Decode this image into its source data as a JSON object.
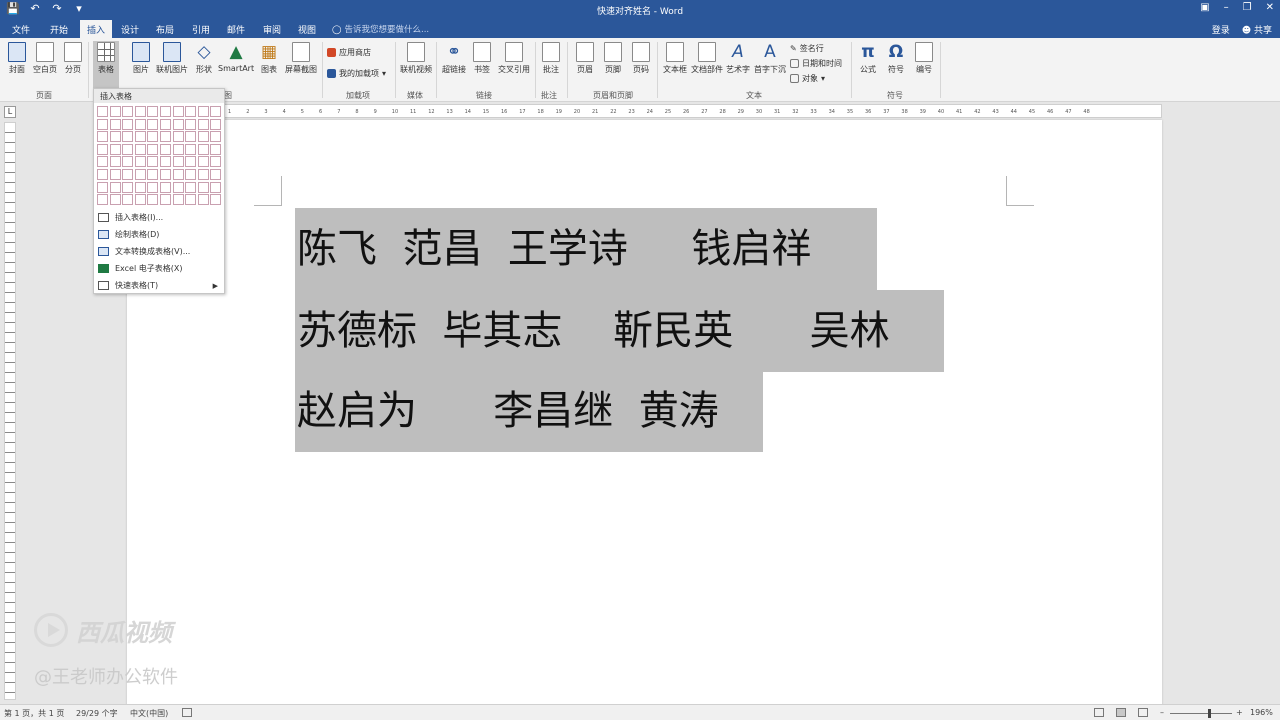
{
  "window": {
    "title": "快速对齐姓名 - Word",
    "qat_icons": [
      "save-icon",
      "undo-icon",
      "redo-icon",
      "customize-icon"
    ]
  },
  "tabs": [
    "文件",
    "开始",
    "插入",
    "设计",
    "布局",
    "引用",
    "邮件",
    "审阅",
    "视图"
  ],
  "active_tab": "插入",
  "tell_me": "告诉我您想要做什么...",
  "account": {
    "signin": "登录",
    "share": "共享"
  },
  "ribbon": {
    "buttons": [
      "封面",
      "空白页",
      "分页",
      "表格",
      "图片",
      "联机图片",
      "形状",
      "SmartArt",
      "图表",
      "屏幕截图",
      "联机视频",
      "超链接",
      "书签",
      "交叉引用",
      "批注",
      "页眉",
      "页脚",
      "页码",
      "文本框",
      "文档部件",
      "艺术字",
      "首字下沉",
      "公式",
      "符号",
      "编号"
    ],
    "addins": [
      "应用商店",
      "我的加载项"
    ],
    "text_small": [
      "签名行",
      "日期和时间",
      "对象"
    ],
    "groups": [
      "页面",
      "图",
      "加载项",
      "媒体",
      "链接",
      "批注",
      "页眉和页脚",
      "文本",
      "符号"
    ]
  },
  "table_menu": {
    "header": "插入表格",
    "items": [
      "插入表格(I)...",
      "绘制表格(D)",
      "文本转换成表格(V)...",
      "Excel 电子表格(X)",
      "快速表格(T)"
    ]
  },
  "ruler_ticks": [
    "1",
    "2",
    "3",
    "4",
    "5",
    "6",
    "7",
    "8",
    "9",
    "10",
    "11",
    "12",
    "13",
    "14",
    "15",
    "16",
    "17",
    "18",
    "19",
    "20",
    "21",
    "22",
    "23",
    "24",
    "25",
    "26",
    "27",
    "28",
    "29",
    "30",
    "31",
    "32",
    "33",
    "34",
    "35",
    "36",
    "37",
    "38",
    "39",
    "40",
    "41",
    "42",
    "43",
    "44",
    "45",
    "46",
    "47",
    "48"
  ],
  "document": {
    "lines": [
      "陈飞  范昌  王学诗     钱启祥",
      "苏德标  毕其志    靳民英      吴林",
      "赵启为      李昌继  黄涛"
    ]
  },
  "watermark": {
    "brand": "西瓜视频",
    "author": "@王老师办公软件"
  },
  "status": {
    "page": "第 1 页，共 1 页",
    "words": "29/29 个字",
    "lang": "中文(中国)",
    "zoom": "196%"
  },
  "colors": {
    "accent": "#2b579a",
    "selection": "#bebebe"
  }
}
